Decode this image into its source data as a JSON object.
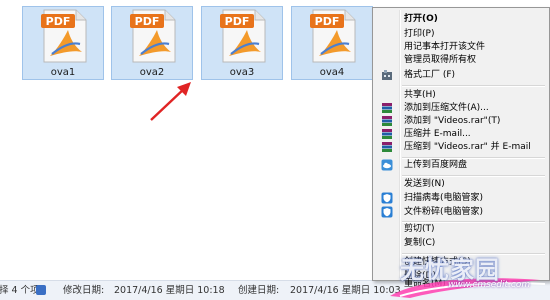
{
  "files": [
    {
      "name": "ova1",
      "icon": "pdf-file-icon",
      "badge": "PDF"
    },
    {
      "name": "ova2",
      "icon": "pdf-file-icon",
      "badge": "PDF"
    },
    {
      "name": "ova3",
      "icon": "pdf-file-icon",
      "badge": "PDF"
    },
    {
      "name": "ova4",
      "icon": "pdf-file-icon",
      "badge": "PDF"
    }
  ],
  "status_bar": {
    "selection": "择 4 个项",
    "modified_label": "修改日期:",
    "modified_value": "2017/4/16 星期日 10:18",
    "created_label": "创建日期:",
    "created_value": "2017/4/16 星期日 10:03"
  },
  "context_menu": {
    "items": [
      {
        "label": "打开(O)",
        "bold": true
      },
      {
        "label": "打印(P)"
      },
      {
        "label": "用记事本打开该文件"
      },
      {
        "label": "管理员取得所有权"
      },
      {
        "label": "格式工厂 (F)",
        "icon": "format-factory-icon"
      },
      {
        "label": "共享(H)"
      },
      {
        "label": "添加到压缩文件(A)...",
        "icon": "winrar-icon"
      },
      {
        "label": "添加到 \"Videos.rar\"(T)",
        "icon": "winrar-icon"
      },
      {
        "label": "压缩并 E-mail...",
        "icon": "winrar-icon"
      },
      {
        "label": "压缩到 \"Videos.rar\" 并 E-mail",
        "icon": "winrar-icon"
      },
      {
        "label": "上传到百度网盘",
        "icon": "baidu-cloud-icon"
      },
      {
        "label": "发送到(N)"
      },
      {
        "label": "扫描病毒(电脑管家)",
        "icon": "pc-manager-shield-icon"
      },
      {
        "label": "文件粉碎(电脑管家)",
        "icon": "pc-manager-shield-icon"
      },
      {
        "label": "剪切(T)"
      },
      {
        "label": "复制(C)"
      },
      {
        "label": "创建快捷方式(S)"
      },
      {
        "label": "删除(D)"
      },
      {
        "label": "重命名(M)"
      }
    ]
  },
  "watermark": {
    "text": "无忧家园",
    "url": "www.cmsedit.com"
  },
  "colors": {
    "selection_bg": "#cfe3f7",
    "selection_border": "#9fc3ea",
    "menu_bg": "#f1f1f1",
    "arrow": "#e02424",
    "pdf_badge": "#e8731a"
  }
}
